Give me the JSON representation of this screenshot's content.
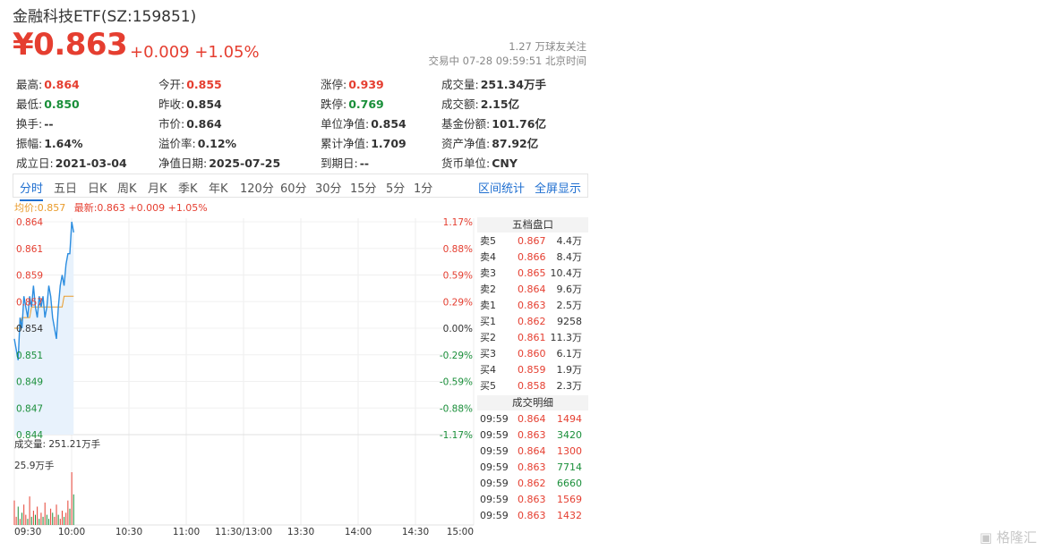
{
  "header": {
    "title": "金融科技ETF(SZ:159851)",
    "price": "¥0.863",
    "change": "+0.009 +1.05%",
    "followers": "1.27 万球友关注",
    "status": "交易中 07-28 09:59:51 北京时间"
  },
  "stats": [
    {
      "label": "最高:",
      "value": "0.864",
      "color": "red"
    },
    {
      "label": "今开:",
      "value": "0.855",
      "color": "red"
    },
    {
      "label": "涨停:",
      "value": "0.939",
      "color": "red"
    },
    {
      "label": "成交量:",
      "value": "251.34万手",
      "color": ""
    },
    {
      "label": "最低:",
      "value": "0.850",
      "color": "green"
    },
    {
      "label": "昨收:",
      "value": "0.854",
      "color": ""
    },
    {
      "label": "跌停:",
      "value": "0.769",
      "color": "green"
    },
    {
      "label": "成交额:",
      "value": "2.15亿",
      "color": ""
    },
    {
      "label": "换手:",
      "value": "--",
      "color": ""
    },
    {
      "label": "市价:",
      "value": "0.864",
      "color": ""
    },
    {
      "label": "单位净值:",
      "value": "0.854",
      "color": ""
    },
    {
      "label": "基金份额:",
      "value": "101.76亿",
      "color": ""
    },
    {
      "label": "振幅:",
      "value": "1.64%",
      "color": ""
    },
    {
      "label": "溢价率:",
      "value": "0.12%",
      "color": ""
    },
    {
      "label": "累计净值:",
      "value": "1.709",
      "color": ""
    },
    {
      "label": "资产净值:",
      "value": "87.92亿",
      "color": ""
    },
    {
      "label": "成立日:",
      "value": "2021-03-04",
      "color": ""
    },
    {
      "label": "净值日期:",
      "value": "2025-07-25",
      "color": ""
    },
    {
      "label": "到期日:",
      "value": "--",
      "color": ""
    },
    {
      "label": "货币单位:",
      "value": "CNY",
      "color": ""
    }
  ],
  "tabs": [
    "分时",
    "五日",
    "日K",
    "周K",
    "月K",
    "季K",
    "年K",
    "120分",
    "60分",
    "30分",
    "15分",
    "5分",
    "1分"
  ],
  "tab_links": [
    "区间统计",
    "全屏显示"
  ],
  "legend": {
    "avg": "均价:0.857",
    "last": "最新:0.863 +0.009 +1.05%"
  },
  "chart_data": {
    "type": "line",
    "price_ticks": [
      "0.864",
      "0.861",
      "0.859",
      "0.857",
      "0.854",
      "0.851",
      "0.849",
      "0.847",
      "0.844"
    ],
    "pct_ticks": [
      "1.17%",
      "0.88%",
      "0.59%",
      "0.29%",
      "0.00%",
      "-0.29%",
      "-0.59%",
      "-0.88%",
      "-1.17%"
    ],
    "time_labels": [
      "09:30",
      "10:00",
      "10:30",
      "11:00",
      "11:30/13:00",
      "13:30",
      "14:00",
      "14:30",
      "15:00"
    ],
    "ylim": [
      0.844,
      0.864
    ],
    "prev_close": 0.854,
    "minutes_total": 240,
    "price_series": [
      0.853,
      0.852,
      0.851,
      0.855,
      0.854,
      0.857,
      0.856,
      0.855,
      0.857,
      0.856,
      0.858,
      0.856,
      0.855,
      0.857,
      0.856,
      0.857,
      0.855,
      0.856,
      0.858,
      0.857,
      0.855,
      0.854,
      0.853,
      0.856,
      0.858,
      0.859,
      0.858,
      0.86,
      0.861,
      0.861,
      0.864,
      0.863
    ],
    "avg_series": [
      0.854,
      0.854,
      0.854,
      0.854,
      0.855,
      0.855,
      0.855,
      0.855,
      0.855,
      0.856,
      0.856,
      0.856,
      0.856,
      0.856,
      0.856,
      0.856,
      0.856,
      0.856,
      0.856,
      0.856,
      0.856,
      0.856,
      0.856,
      0.856,
      0.856,
      0.856,
      0.857,
      0.857,
      0.857,
      0.857,
      0.857,
      0.857
    ],
    "volume_label": "成交量: 251.21万手",
    "volume_max_label": "25.9万手",
    "volume_max": 25.9,
    "volume_series": [
      12,
      4,
      9,
      3,
      6,
      10,
      5,
      3,
      14,
      4,
      7,
      5,
      9,
      3,
      6,
      4,
      11,
      5,
      3,
      8,
      6,
      4,
      10,
      5,
      3,
      7,
      4,
      6,
      12,
      8,
      25.9,
      15
    ],
    "volume_colors": [
      "red",
      "red",
      "green",
      "red",
      "green",
      "red",
      "red",
      "green",
      "red",
      "green",
      "red",
      "green",
      "red",
      "green",
      "red",
      "green",
      "red",
      "green",
      "green",
      "red",
      "green",
      "red",
      "red",
      "green",
      "red",
      "red",
      "green",
      "red",
      "red",
      "green",
      "red",
      "green"
    ]
  },
  "order_book": {
    "title": "五档盘口",
    "asks": [
      {
        "label": "卖5",
        "price": "0.867",
        "vol": "4.4万"
      },
      {
        "label": "卖4",
        "price": "0.866",
        "vol": "8.4万"
      },
      {
        "label": "卖3",
        "price": "0.865",
        "vol": "10.4万"
      },
      {
        "label": "卖2",
        "price": "0.864",
        "vol": "9.6万"
      },
      {
        "label": "卖1",
        "price": "0.863",
        "vol": "2.5万"
      }
    ],
    "bids": [
      {
        "label": "买1",
        "price": "0.862",
        "vol": "9258"
      },
      {
        "label": "买2",
        "price": "0.861",
        "vol": "11.3万"
      },
      {
        "label": "买3",
        "price": "0.860",
        "vol": "6.1万"
      },
      {
        "label": "买4",
        "price": "0.859",
        "vol": "1.9万"
      },
      {
        "label": "买5",
        "price": "0.858",
        "vol": "2.3万"
      }
    ],
    "trades_title": "成交明细",
    "trades": [
      {
        "time": "09:59",
        "price": "0.864",
        "vol": "1494",
        "dir": "red"
      },
      {
        "time": "09:59",
        "price": "0.863",
        "vol": "3420",
        "dir": "green"
      },
      {
        "time": "09:59",
        "price": "0.864",
        "vol": "1300",
        "dir": "red"
      },
      {
        "time": "09:59",
        "price": "0.863",
        "vol": "7714",
        "dir": "green"
      },
      {
        "time": "09:59",
        "price": "0.862",
        "vol": "6660",
        "dir": "green"
      },
      {
        "time": "09:59",
        "price": "0.863",
        "vol": "1569",
        "dir": "red"
      },
      {
        "time": "09:59",
        "price": "0.863",
        "vol": "1432",
        "dir": "red"
      }
    ]
  },
  "watermark": "格隆汇",
  "colors": {
    "up": "#e53e30",
    "down": "#1a8f3a",
    "line": "#2b8de0",
    "avg": "#e99b2b",
    "accent": "#1f6fd0"
  }
}
